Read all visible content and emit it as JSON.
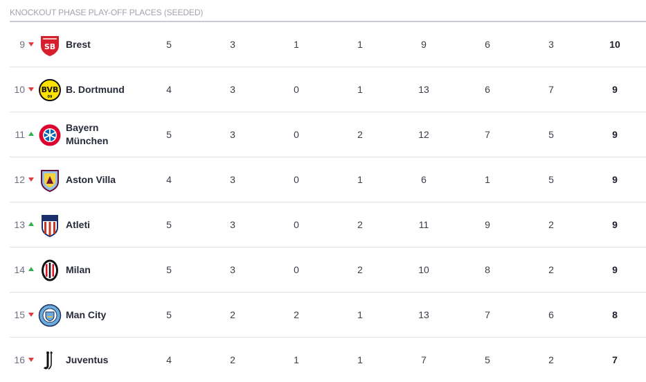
{
  "section": {
    "title": "KNOCKOUT PHASE PLAY-OFF PLACES (SEEDED)"
  },
  "colors": {
    "trend_up": "#2fb04a",
    "trend_down": "#e03a3a",
    "divider": "#dfe1e6"
  },
  "rows": [
    {
      "pos": "9",
      "trend": "down",
      "crest": "brest-crest-icon",
      "club": "Brest",
      "cells": [
        "5",
        "3",
        "1",
        "1",
        "9",
        "6",
        "3",
        "10"
      ]
    },
    {
      "pos": "10",
      "trend": "down",
      "crest": "dortmund-crest-icon",
      "club": "B. Dortmund",
      "cells": [
        "4",
        "3",
        "0",
        "1",
        "13",
        "6",
        "7",
        "9"
      ]
    },
    {
      "pos": "11",
      "trend": "up",
      "crest": "bayern-crest-icon",
      "club": "Bayern München",
      "cells": [
        "5",
        "3",
        "0",
        "2",
        "12",
        "7",
        "5",
        "9"
      ]
    },
    {
      "pos": "12",
      "trend": "down",
      "crest": "villa-crest-icon",
      "club": "Aston Villa",
      "cells": [
        "4",
        "3",
        "0",
        "1",
        "6",
        "1",
        "5",
        "9"
      ]
    },
    {
      "pos": "13",
      "trend": "up",
      "crest": "atleti-crest-icon",
      "club": "Atleti",
      "cells": [
        "5",
        "3",
        "0",
        "2",
        "11",
        "9",
        "2",
        "9"
      ]
    },
    {
      "pos": "14",
      "trend": "up",
      "crest": "milan-crest-icon",
      "club": "Milan",
      "cells": [
        "5",
        "3",
        "0",
        "2",
        "10",
        "8",
        "2",
        "9"
      ]
    },
    {
      "pos": "15",
      "trend": "down",
      "crest": "mancity-crest-icon",
      "club": "Man City",
      "cells": [
        "5",
        "2",
        "2",
        "1",
        "13",
        "7",
        "6",
        "8"
      ]
    },
    {
      "pos": "16",
      "trend": "down",
      "crest": "juventus-crest-icon",
      "club": "Juventus",
      "cells": [
        "4",
        "2",
        "1",
        "1",
        "7",
        "5",
        "2",
        "7"
      ]
    }
  ]
}
